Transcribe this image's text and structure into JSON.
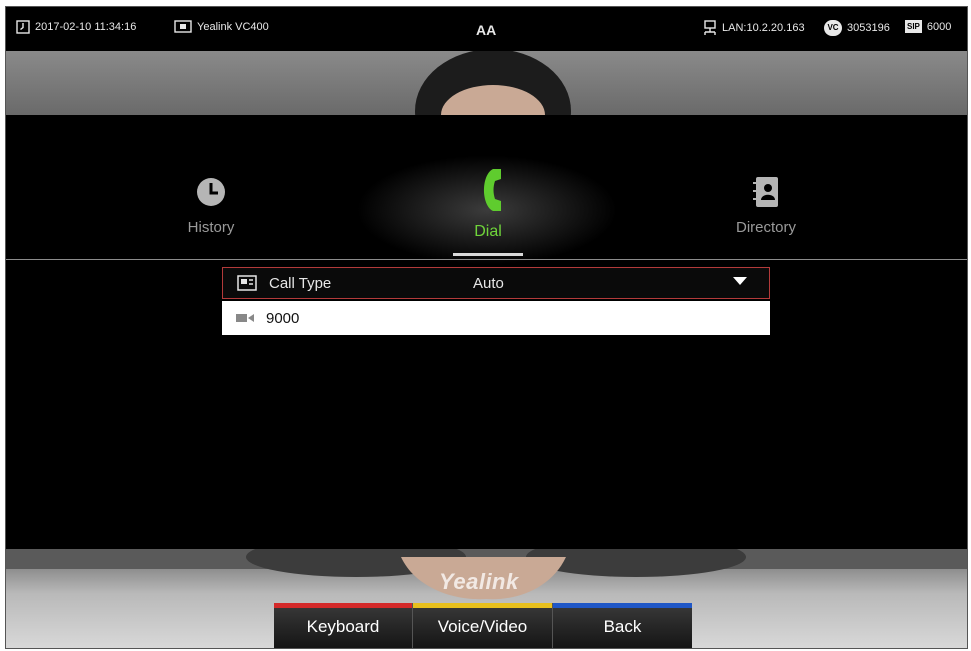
{
  "status_bar": {
    "datetime": "2017-02-10 11:34:16",
    "device_name": "Yealink VC400",
    "center_glyph": "AA",
    "lan": "LAN:10.2.20.163",
    "vc_account": "3053196",
    "vc_badge": "VC",
    "sip_badge": "SIP",
    "sip_account": "6000"
  },
  "tabs": [
    {
      "label": "History",
      "icon": "clock-icon"
    },
    {
      "label": "Dial",
      "icon": "phone-handset-icon",
      "active": true
    },
    {
      "label": "Directory",
      "icon": "address-book-icon"
    }
  ],
  "dial_form": {
    "call_type_label": "Call Type",
    "call_type_value": "Auto",
    "number_value": "9000"
  },
  "softkeys": [
    {
      "label": "Keyboard",
      "color": "#d42a2a"
    },
    {
      "label": "Voice/Video",
      "color": "#e8c01e"
    },
    {
      "label": "Back",
      "color": "#1f57c7"
    }
  ],
  "brand": "Yealink",
  "colors": {
    "accent_green": "#6fd43a",
    "focus_border": "#b33a3a"
  }
}
